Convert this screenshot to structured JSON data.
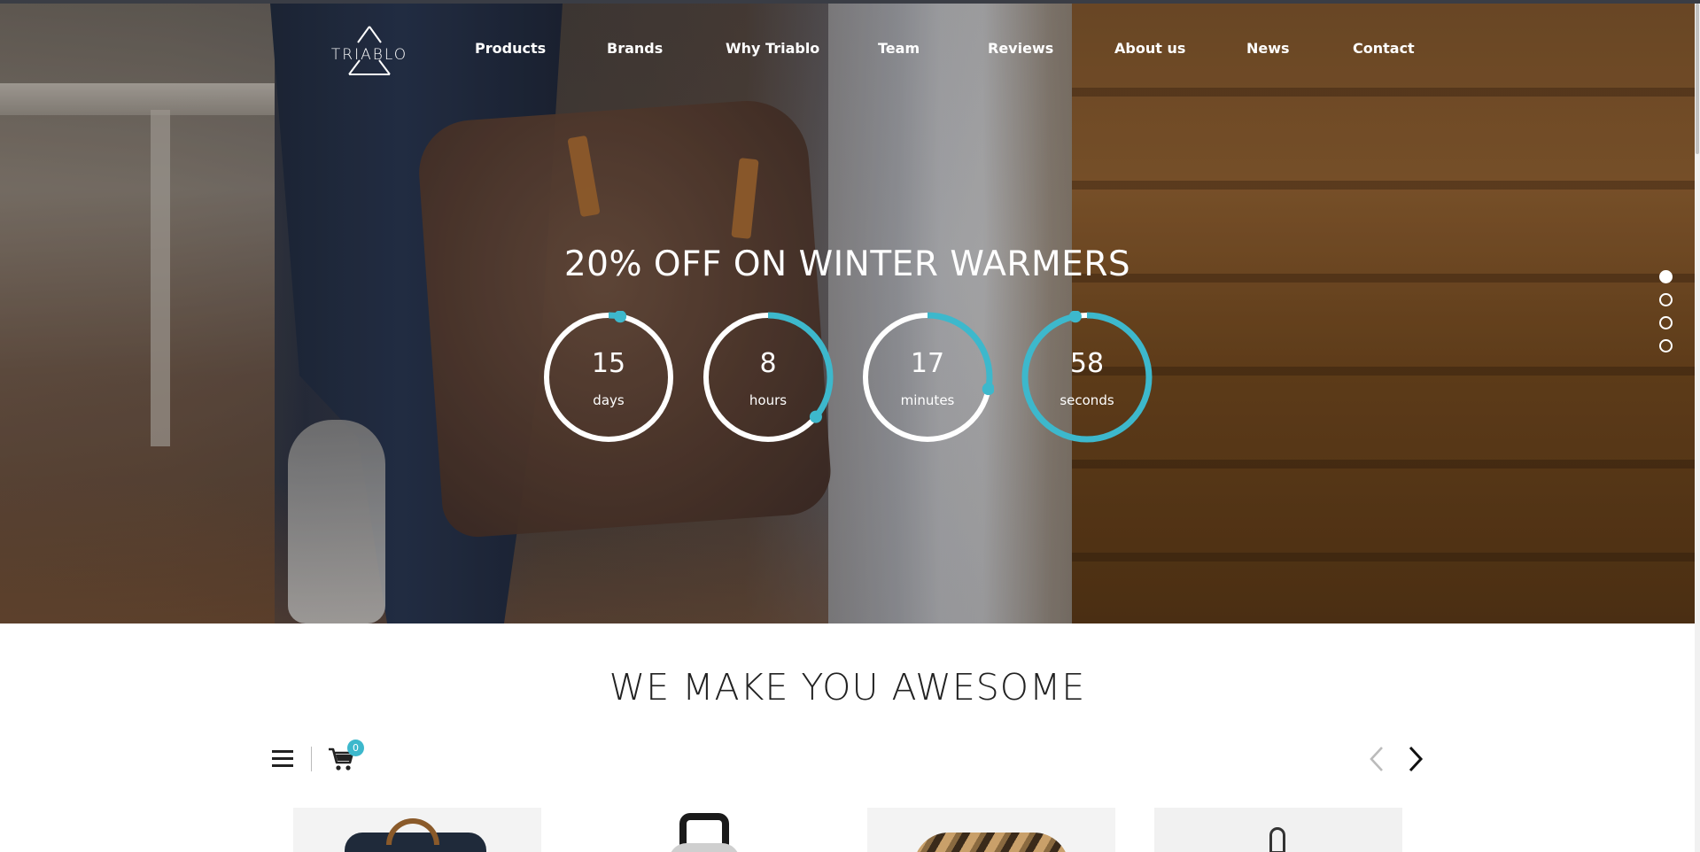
{
  "brand": {
    "logo_text": "TRIABLO"
  },
  "nav": {
    "items": [
      "Products",
      "Brands",
      "Why Triablo",
      "Team",
      "Reviews",
      "About us",
      "News",
      "Contact"
    ]
  },
  "hero": {
    "promo_title": "20% OFF ON WINTER WARMERS",
    "countdown": [
      {
        "value": "15",
        "unit": "days",
        "progress": 0.03
      },
      {
        "value": "8",
        "unit": "hours",
        "progress": 0.36
      },
      {
        "value": "17",
        "unit": "minutes",
        "progress": 0.28
      },
      {
        "value": "58",
        "unit": "seconds",
        "progress": 0.97
      }
    ],
    "slides": {
      "count": 4,
      "active_index": 0
    }
  },
  "section": {
    "title": "WE MAKE YOU AWESOME",
    "cart_count": "0"
  },
  "colors": {
    "accent": "#3db8cc",
    "ring": "#ffffff",
    "text_dark": "#222222"
  },
  "icons": [
    "triablo-logo",
    "menu-icon",
    "cart-icon",
    "chevron-left-icon",
    "chevron-right-icon"
  ]
}
